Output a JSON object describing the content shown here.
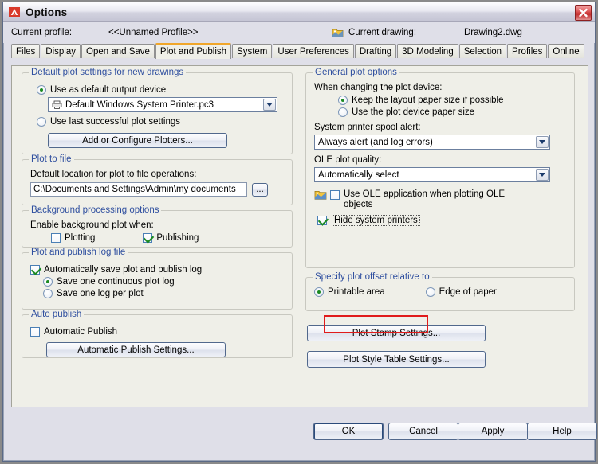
{
  "window": {
    "title": "Options",
    "app_icon": "autocad-a-icon",
    "close_icon": "close-icon"
  },
  "header": {
    "profile_label": "Current profile:",
    "profile_value": "<<Unnamed Profile>>",
    "drawing_icon": "drawing-file-icon",
    "drawing_label": "Current drawing:",
    "drawing_value": "Drawing2.dwg"
  },
  "tabs": [
    {
      "label": "Files",
      "active": false
    },
    {
      "label": "Display",
      "active": false
    },
    {
      "label": "Open and Save",
      "active": false
    },
    {
      "label": "Plot and Publish",
      "active": true
    },
    {
      "label": "System",
      "active": false
    },
    {
      "label": "User Preferences",
      "active": false
    },
    {
      "label": "Drafting",
      "active": false
    },
    {
      "label": "3D Modeling",
      "active": false
    },
    {
      "label": "Selection",
      "active": false
    },
    {
      "label": "Profiles",
      "active": false
    },
    {
      "label": "Online",
      "active": false
    }
  ],
  "default_plot_settings": {
    "legend": "Default plot settings for new drawings",
    "radio_default_device": "Use as default output device",
    "device_value": "Default Windows System Printer.pc3",
    "device_icon": "plotter-icon",
    "radio_last_successful": "Use last successful plot settings",
    "selected": "default_device",
    "add_configure_button": "Add or Configure Plotters..."
  },
  "plot_to_file": {
    "legend": "Plot to file",
    "field_label": "Default location for plot to file operations:",
    "path_value": "C:\\Documents and Settings\\Admin\\my documents",
    "browse_button": "...",
    "browse_icon": "ellipsis-browse-icon"
  },
  "background_processing": {
    "legend": "Background processing options",
    "sub_label": "Enable background plot when:",
    "plotting_label": "Plotting",
    "plotting_checked": false,
    "publishing_label": "Publishing",
    "publishing_checked": true
  },
  "log_file": {
    "legend": "Plot and publish log file",
    "auto_save_label": "Automatically save plot and publish log",
    "auto_save_checked": true,
    "continuous_label": "Save one continuous plot log",
    "per_plot_label": "Save one log per plot",
    "selected": "continuous"
  },
  "auto_publish": {
    "legend": "Auto publish",
    "checkbox_label": "Automatic Publish",
    "checkbox_checked": false,
    "settings_button": "Automatic Publish Settings..."
  },
  "general_plot_options": {
    "legend": "General plot options",
    "device_change_label": "When changing the plot device:",
    "keep_layout_label": "Keep the layout paper size if possible",
    "use_device_size_label": "Use the plot device paper size",
    "selected": "keep_layout",
    "spool_alert_label": "System printer spool alert:",
    "spool_alert_value": "Always alert (and log errors)",
    "ole_quality_label": "OLE plot quality:",
    "ole_quality_value": "Automatically select",
    "ole_app_icon": "ole-object-icon",
    "ole_app_label_line1": "Use OLE application when plotting OLE",
    "ole_app_label_line2": "objects",
    "ole_app_checked": false,
    "hide_system_printers_label": "Hide system printers",
    "hide_system_printers_checked": true
  },
  "plot_offset": {
    "legend": "Specify plot offset relative to",
    "printable_area_label": "Printable area",
    "edge_of_paper_label": "Edge of paper",
    "selected": "printable_area"
  },
  "right_buttons": {
    "plot_stamp": "Plot Stamp Settings...",
    "plot_style_table": "Plot Style Table Settings..."
  },
  "dialog_buttons": {
    "ok": "OK",
    "cancel": "Cancel",
    "apply": "Apply",
    "help": "Help"
  },
  "annotation": {
    "highlight_color": "#e01b1b",
    "highlight_target": "hide-system-printers-checkbox"
  },
  "colors": {
    "accent_tab": "#f0a62a",
    "legend_text": "#2f4f9f",
    "check_green": "#1b8a22",
    "panel_bg": "#efefe8",
    "dialog_bg": "#dfdfe8"
  }
}
